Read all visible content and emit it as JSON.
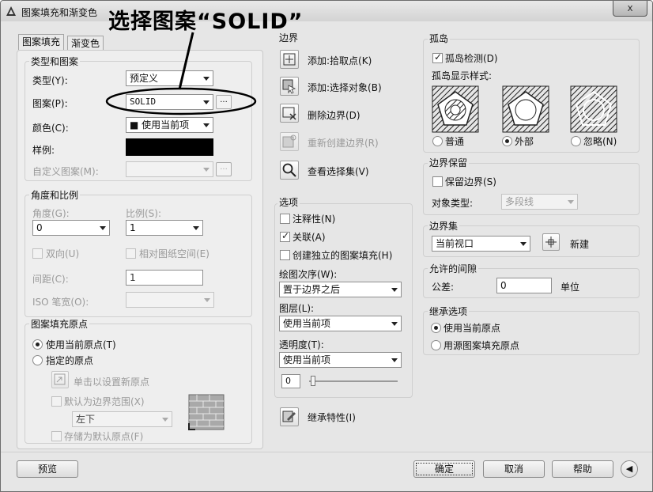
{
  "window": {
    "title": "图案填充和渐变色",
    "close": "x"
  },
  "annotation": "选择图案“SOLID”",
  "tabs": [
    "图案填充",
    "渐变色"
  ],
  "type_pattern": {
    "group": "类型和图案",
    "type_label": "类型(Y):",
    "type_value": "预定义",
    "pattern_label": "图案(P):",
    "pattern_value": "SOLID",
    "browse": "...",
    "color_label": "颜色(C):",
    "color_value": "■ 使用当前项",
    "sample_label": "样例:",
    "custom_label": "自定义图案(M):",
    "swatch_color": "#000000"
  },
  "angle_scale": {
    "group": "角度和比例",
    "angle_label": "角度(G):",
    "angle_value": "0",
    "scale_label": "比例(S):",
    "scale_value": "1",
    "double_label": "双向(U)",
    "paper_label": "相对图纸空间(E)",
    "spacing_label": "间距(C):",
    "spacing_value": "1",
    "iso_label": "ISO 笔宽(O):"
  },
  "origin": {
    "group": "图案填充原点",
    "current_label": "使用当前原点(T)",
    "specified_label": "指定的原点",
    "click_label": "单击以设置新原点",
    "default_extent_label": "默认为边界范围(X)",
    "extent_value": "左下",
    "store_label": "存储为默认原点(F)"
  },
  "boundary": {
    "group": "边界",
    "pick_label": "添加:拾取点(K)",
    "select_label": "添加:选择对象(B)",
    "remove_label": "删除边界(D)",
    "recreate_label": "重新创建边界(R)",
    "view_label": "查看选择集(V)"
  },
  "options": {
    "group": "选项",
    "annotative_label": "注释性(N)",
    "associative_label": "关联(A)",
    "separate_label": "创建独立的图案填充(H)",
    "draw_order_label": "绘图次序(W):",
    "draw_order_value": "置于边界之后",
    "layer_label": "图层(L):",
    "layer_value": "使用当前项",
    "transparency_label": "透明度(T):",
    "transparency_value": "使用当前项",
    "transparency_number": "0",
    "transparency_slider_level": 0
  },
  "inherit_label": "继承特性(I)",
  "islands": {
    "group": "孤岛",
    "detect_label": "孤岛检测(D)",
    "style_label": "孤岛显示样式:",
    "normal_label": "普通",
    "outer_label": "外部",
    "ignore_label": "忽略(N)"
  },
  "retain": {
    "group": "边界保留",
    "retain_label": "保留边界(S)",
    "object_type_label": "对象类型:",
    "object_type_value": "多段线"
  },
  "boundary_set": {
    "group": "边界集",
    "value": "当前视口",
    "new_label": "新建"
  },
  "gap": {
    "group": "允许的间隙",
    "tolerance_label": "公差:",
    "tolerance_value": "0",
    "unit_label": "单位"
  },
  "inherit_options": {
    "group": "继承选项",
    "current_label": "使用当前原点",
    "source_label": "用源图案填充原点"
  },
  "footer": {
    "preview": "预览",
    "ok": "确定",
    "cancel": "取消",
    "help": "帮助",
    "more": "◀"
  }
}
